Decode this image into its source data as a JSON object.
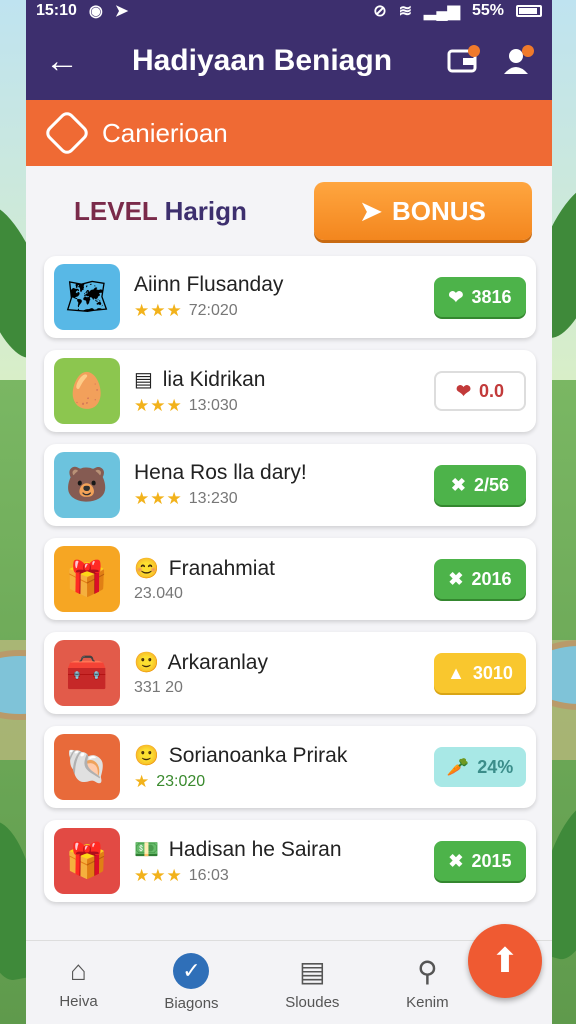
{
  "status": {
    "time": "15:10",
    "battery": "55%"
  },
  "header": {
    "title": "Hadiyaan Beniagn"
  },
  "banner": {
    "label": "Canierioan"
  },
  "level": {
    "prefix": "LEVEL",
    "name": "Harign"
  },
  "bonus": {
    "label": "BONUS"
  },
  "items": [
    {
      "name": "Aiinn Flusanday",
      "stars": "★★★",
      "sub": "72:020",
      "badge": "3816",
      "badge_icon": "❤",
      "style": "green",
      "thumb_bg": "#58b8e6",
      "thumb_icon": "🗺"
    },
    {
      "name": "lia Kidrikan",
      "prefix": "▤",
      "stars": "★★★",
      "sub": "13:030",
      "badge": "0.0",
      "badge_icon": "❤",
      "style": "white",
      "thumb_bg": "#8cc64f",
      "thumb_icon": "🥚"
    },
    {
      "name": "Hena Ros lla dary!",
      "stars": "★★★",
      "sub": "13:230",
      "badge": "2/56",
      "badge_icon": "✖",
      "style": "green",
      "thumb_bg": "#6cc3de",
      "thumb_icon": "🐻"
    },
    {
      "name": "Franahmiat",
      "prefix": "😊",
      "stars": "",
      "sub": "23.040",
      "badge": "2016",
      "badge_icon": "✖",
      "style": "green",
      "thumb_bg": "#f6a623",
      "thumb_icon": "🎁"
    },
    {
      "name": "Arkaranlay",
      "prefix": "🙂",
      "stars": "",
      "sub": "331 20",
      "badge": "3010",
      "badge_icon": "▲",
      "style": "yellow",
      "thumb_bg": "#e25b4a",
      "thumb_icon": "🧰"
    },
    {
      "name": "Sorianoanka Prirak",
      "prefix": "🙂",
      "stars": "★",
      "sub": "23:020",
      "badge": "24%",
      "badge_icon": "🥕",
      "style": "teal",
      "thumb_bg": "#e86a3a",
      "thumb_icon": "🐚"
    },
    {
      "name": "Hadisan he Sairan",
      "prefix": "💵",
      "stars": "★★★",
      "sub": "16:03",
      "badge": "2015",
      "badge_icon": "✖",
      "style": "green",
      "thumb_bg": "#e24a44",
      "thumb_icon": "🎁"
    }
  ],
  "nav": [
    {
      "label": "Heiva",
      "icon": "⌂"
    },
    {
      "label": "Biagons",
      "icon": "✓"
    },
    {
      "label": "Sloudes",
      "icon": "▤"
    },
    {
      "label": "Kenim",
      "icon": "⚲"
    }
  ],
  "fab_icon": "⬆",
  "colors": {
    "topbar": "#3d2f6e",
    "banner": "#ef6a34",
    "bonus": "#f3861e",
    "badge_green": "#4db34a"
  }
}
